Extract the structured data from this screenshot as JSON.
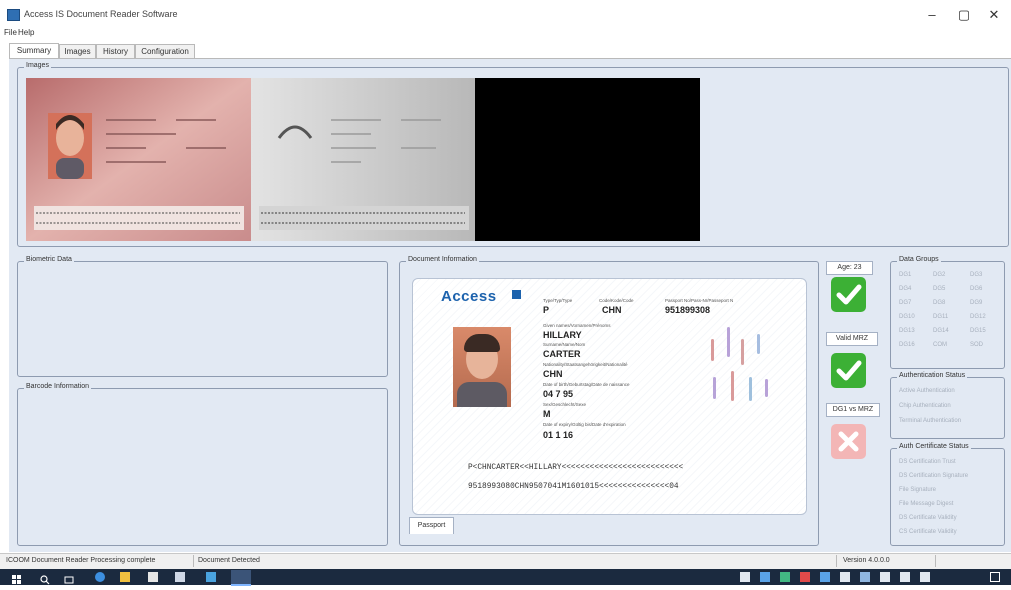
{
  "window": {
    "title": "Access IS Document Reader Software",
    "minimize": "–",
    "maximize": "▢",
    "close": "✕"
  },
  "menu": [
    "File",
    "Help"
  ],
  "tabs": [
    "Summary",
    "Images",
    "History",
    "Configuration"
  ],
  "groups": {
    "images": "Images",
    "biometric": "Biometric Data",
    "barcode": "Barcode Information",
    "document": "Document Information",
    "data_groups": "Data Groups",
    "auth_status": "Authentication Status",
    "auth_cert": "Auth Certificate Status"
  },
  "card": {
    "logo": "Access",
    "type_caption": "Type/Typ/Type",
    "type_value": "P",
    "code_caption": "Code/Kode/Code",
    "code_value": "CHN",
    "passport_caption": "Passport No/Pass-Nr/Passeport N",
    "passport_value": "951899308",
    "given_caption": "Given names/Vornamen/Prénoms",
    "given_value": "HILLARY",
    "surname_caption": "Surname/Name/Nom",
    "surname_value": "CARTER",
    "nationality_caption": "Nationality/Staatsangehörigkeit/Nationalité",
    "nationality_value": "CHN",
    "dob_caption": "Date of birth/Geburtstag/Date de naissance",
    "dob_value": "04 7 95",
    "sex_caption": "Sex/Geschlecht/Sexe",
    "sex_value": "M",
    "expiry_caption": "Date of expiry/Gültig bis/Date d'expiration",
    "expiry_value": "01 1 16",
    "mrz_line1": "P<CHNCARTER<<HILLARY<<<<<<<<<<<<<<<<<<<<<<<<<<",
    "mrz_line2": "9518993080CHN9507041M1601015<<<<<<<<<<<<<<<04"
  },
  "doc_tab": "Passport",
  "status": {
    "age": "Age: 23",
    "valid_mrz": "Valid MRZ",
    "dg1_mrz": "DG1 vs MRZ"
  },
  "data_groups": [
    "DG1",
    "DG2",
    "DG3",
    "DG4",
    "DG5",
    "DG6",
    "DG7",
    "DG8",
    "DG9",
    "DG10",
    "DG11",
    "DG12",
    "DG13",
    "DG14",
    "DG15",
    "DG16",
    "COM",
    "SOD"
  ],
  "auth_status_items": [
    "Active Authentication",
    "Chip Authentication",
    "Terminal Authentication"
  ],
  "auth_cert_items": [
    "DS Certification Trust",
    "DS Certification Signature",
    "File Signature",
    "File Message Digest",
    "DS Certificate Validity",
    "CS Certificate Validity"
  ],
  "statusbar": {
    "processing": "ICOOM Document Reader Processing complete",
    "detected": "Document Detected",
    "version": "Version 4.0.0.0"
  },
  "colors": {
    "panel_bg": "#e2e9f3",
    "pass_green": "#3cb035",
    "fail_red": "#f3b6b6"
  }
}
